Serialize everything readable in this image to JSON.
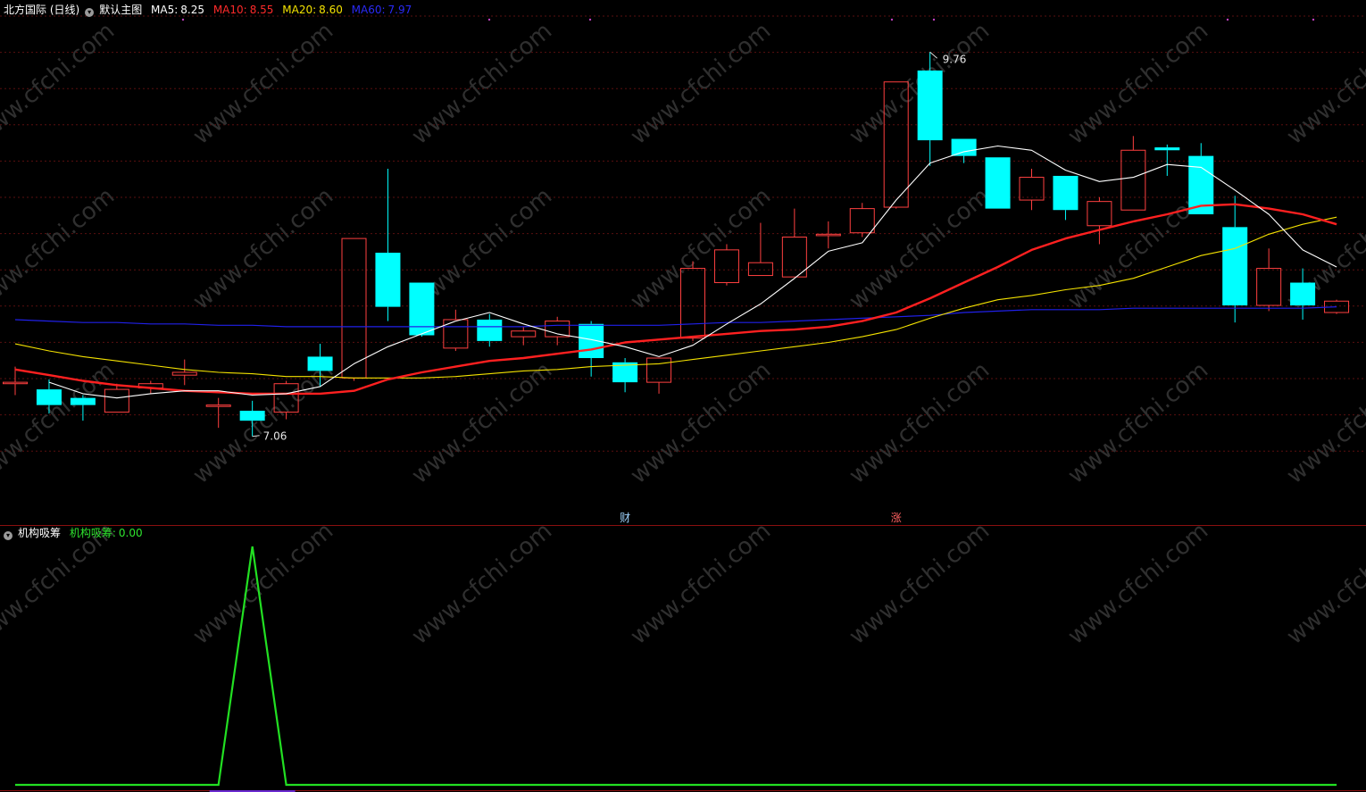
{
  "header": {
    "stock": "北方国际 (日线)",
    "main_chart_label": "默认主图",
    "ma5_label": "MA5:",
    "ma5_value": "8.25",
    "ma10_label": "MA10:",
    "ma10_value": "8.55",
    "ma20_label": "MA20:",
    "ma20_value": "8.60",
    "ma60_label": "MA60:",
    "ma60_value": "7.97"
  },
  "sub_header": {
    "indicator_name": "机构吸筹",
    "value_label": "机构吸筹:",
    "value": "0.00"
  },
  "colors": {
    "up": "#ff4040",
    "down": "#00ffff",
    "ma5": "#ffffff",
    "ma10": "#ff2020",
    "ma20": "#f4e200",
    "ma60": "#2020e8",
    "indicator": "#22e022",
    "grid": "#5a0f0f",
    "watermark": "#2f2f2f"
  },
  "watermark": "www.cfchi.com",
  "chart_data": {
    "type": "candlestick",
    "y_main": [
      6.55,
      10.0
    ],
    "y_sub": [
      0,
      1
    ],
    "markers": [
      {
        "text": "9.76",
        "candle": 27,
        "price": 9.76,
        "kind": "high"
      },
      {
        "text": "7.06",
        "candle": 7,
        "price": 7.06,
        "kind": "low"
      }
    ],
    "events": [
      {
        "text": "财",
        "candle": 18,
        "color": "#9fd4ff"
      },
      {
        "text": "涨",
        "candle": 26,
        "color": "#ff6060"
      }
    ],
    "candles": [
      {
        "o": 7.43,
        "c": 7.44,
        "h": 7.55,
        "l": 7.35
      },
      {
        "o": 7.39,
        "c": 7.28,
        "h": 7.46,
        "l": 7.22
      },
      {
        "o": 7.33,
        "c": 7.28,
        "h": 7.35,
        "l": 7.17
      },
      {
        "o": 7.23,
        "c": 7.39,
        "h": 7.43,
        "l": 7.23
      },
      {
        "o": 7.4,
        "c": 7.43,
        "h": 7.45,
        "l": 7.36
      },
      {
        "o": 7.49,
        "c": 7.51,
        "h": 7.6,
        "l": 7.42
      },
      {
        "o": 7.27,
        "c": 7.28,
        "h": 7.33,
        "l": 7.12
      },
      {
        "o": 7.24,
        "c": 7.17,
        "h": 7.31,
        "l": 7.06
      },
      {
        "o": 7.23,
        "c": 7.43,
        "h": 7.45,
        "l": 7.18
      },
      {
        "o": 7.62,
        "c": 7.52,
        "h": 7.71,
        "l": 7.41
      },
      {
        "o": 7.47,
        "c": 8.45,
        "h": 8.45,
        "l": 7.45
      },
      {
        "o": 8.35,
        "c": 7.97,
        "h": 8.94,
        "l": 7.87
      },
      {
        "o": 8.14,
        "c": 7.77,
        "h": 8.14,
        "l": 7.76
      },
      {
        "o": 7.68,
        "c": 7.88,
        "h": 7.95,
        "l": 7.66
      },
      {
        "o": 7.88,
        "c": 7.73,
        "h": 7.92,
        "l": 7.69
      },
      {
        "o": 7.76,
        "c": 7.8,
        "h": 7.83,
        "l": 7.7
      },
      {
        "o": 7.76,
        "c": 7.87,
        "h": 7.9,
        "l": 7.7
      },
      {
        "o": 7.85,
        "c": 7.61,
        "h": 7.87,
        "l": 7.48
      },
      {
        "o": 7.58,
        "c": 7.44,
        "h": 7.61,
        "l": 7.37
      },
      {
        "o": 7.44,
        "c": 7.61,
        "h": 7.61,
        "l": 7.36
      },
      {
        "o": 7.75,
        "c": 8.24,
        "h": 8.29,
        "l": 7.73
      },
      {
        "o": 8.14,
        "c": 8.37,
        "h": 8.41,
        "l": 8.12
      },
      {
        "o": 8.19,
        "c": 8.28,
        "h": 8.56,
        "l": 8.19
      },
      {
        "o": 8.18,
        "c": 8.46,
        "h": 8.66,
        "l": 8.18
      },
      {
        "o": 8.47,
        "c": 8.48,
        "h": 8.57,
        "l": 8.38
      },
      {
        "o": 8.49,
        "c": 8.66,
        "h": 8.7,
        "l": 8.46
      },
      {
        "o": 8.67,
        "c": 9.55,
        "h": 9.55,
        "l": 8.66
      },
      {
        "o": 9.63,
        "c": 9.14,
        "h": 9.76,
        "l": 8.96
      },
      {
        "o": 9.15,
        "c": 9.03,
        "h": 9.15,
        "l": 8.98
      },
      {
        "o": 9.02,
        "c": 8.66,
        "h": 9.02,
        "l": 8.66
      },
      {
        "o": 8.72,
        "c": 8.88,
        "h": 8.94,
        "l": 8.65
      },
      {
        "o": 8.89,
        "c": 8.65,
        "h": 8.89,
        "l": 8.58
      },
      {
        "o": 8.54,
        "c": 8.71,
        "h": 8.74,
        "l": 8.41
      },
      {
        "o": 8.65,
        "c": 9.07,
        "h": 9.17,
        "l": 8.65
      },
      {
        "o": 9.09,
        "c": 9.07,
        "h": 9.11,
        "l": 8.89
      },
      {
        "o": 9.03,
        "c": 8.62,
        "h": 9.12,
        "l": 8.62
      },
      {
        "o": 8.53,
        "c": 7.98,
        "h": 8.75,
        "l": 7.86
      },
      {
        "o": 7.98,
        "c": 8.24,
        "h": 8.38,
        "l": 7.94
      },
      {
        "o": 8.14,
        "c": 7.98,
        "h": 8.24,
        "l": 7.88
      },
      {
        "o": 7.93,
        "c": 8.01,
        "h": 8.02,
        "l": 7.92
      }
    ],
    "ma5": [
      null,
      7.44,
      7.36,
      7.33,
      7.36,
      7.38,
      7.38,
      7.35,
      7.36,
      7.41,
      7.57,
      7.69,
      7.78,
      7.87,
      7.93,
      7.85,
      7.78,
      7.74,
      7.69,
      7.62,
      7.7,
      7.85,
      7.99,
      8.17,
      8.36,
      8.42,
      8.72,
      8.98,
      9.06,
      9.1,
      9.07,
      8.93,
      8.85,
      8.88,
      8.97,
      8.95,
      8.79,
      8.62,
      8.37,
      8.25
    ],
    "ma10": [
      7.53,
      7.49,
      7.45,
      7.42,
      7.4,
      7.38,
      7.37,
      7.36,
      7.36,
      7.36,
      7.38,
      7.46,
      7.51,
      7.55,
      7.59,
      7.61,
      7.64,
      7.67,
      7.72,
      7.74,
      7.76,
      7.78,
      7.8,
      7.81,
      7.83,
      7.87,
      7.93,
      8.03,
      8.14,
      8.25,
      8.37,
      8.45,
      8.51,
      8.57,
      8.62,
      8.68,
      8.69,
      8.66,
      8.62,
      8.55
    ],
    "ma20": [
      7.71,
      7.66,
      7.62,
      7.59,
      7.56,
      7.53,
      7.51,
      7.5,
      7.48,
      7.48,
      7.47,
      7.47,
      7.47,
      7.48,
      7.5,
      7.52,
      7.53,
      7.55,
      7.56,
      7.57,
      7.6,
      7.63,
      7.66,
      7.69,
      7.72,
      7.76,
      7.81,
      7.89,
      7.96,
      8.02,
      8.05,
      8.09,
      8.12,
      8.17,
      8.25,
      8.33,
      8.38,
      8.48,
      8.55,
      8.6
    ],
    "ma60": [
      7.88,
      7.87,
      7.86,
      7.86,
      7.85,
      7.85,
      7.84,
      7.84,
      7.83,
      7.83,
      7.83,
      7.83,
      7.83,
      7.83,
      7.83,
      7.83,
      7.84,
      7.84,
      7.84,
      7.84,
      7.85,
      7.86,
      7.86,
      7.87,
      7.88,
      7.89,
      7.9,
      7.91,
      7.93,
      7.94,
      7.95,
      7.95,
      7.95,
      7.96,
      7.96,
      7.96,
      7.96,
      7.96,
      7.96,
      7.97
    ],
    "indicator": [
      0,
      0,
      0,
      0,
      0,
      0,
      0,
      1,
      0,
      0,
      0,
      0,
      0,
      0,
      0,
      0,
      0,
      0,
      0,
      0,
      0,
      0,
      0,
      0,
      0,
      0,
      0,
      0,
      0,
      0,
      0,
      0,
      0,
      0,
      0,
      0,
      0,
      0,
      0,
      0
    ]
  }
}
